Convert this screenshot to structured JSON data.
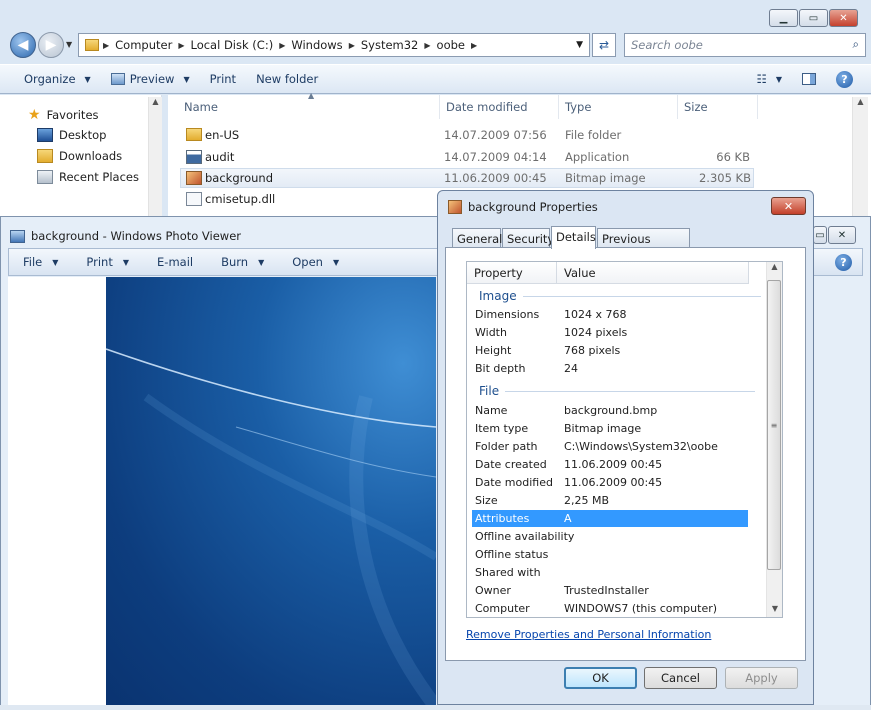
{
  "explorer": {
    "breadcrumbs": [
      "Computer",
      "Local Disk (C:)",
      "Windows",
      "System32",
      "oobe"
    ],
    "search_placeholder": "Search oobe",
    "toolbar": {
      "organize": "Organize",
      "preview": "Preview",
      "print": "Print",
      "new_folder": "New folder"
    },
    "nav": [
      {
        "label": "Favorites"
      },
      {
        "label": "Desktop"
      },
      {
        "label": "Downloads"
      },
      {
        "label": "Recent Places"
      }
    ],
    "columns": {
      "name": "Name",
      "date": "Date modified",
      "type": "Type",
      "size": "Size"
    },
    "files": [
      {
        "name": "en-US",
        "date": "14.07.2009 07:56",
        "type": "File folder",
        "size": ""
      },
      {
        "name": "audit",
        "date": "14.07.2009 04:14",
        "type": "Application",
        "size": "66 KB"
      },
      {
        "name": "background",
        "date": "11.06.2009 00:45",
        "type": "Bitmap image",
        "size": "2.305 KB"
      },
      {
        "name": "cmisetup.dll",
        "date": "",
        "type": "",
        "size": ""
      }
    ]
  },
  "viewer": {
    "title": "background - Windows Photo Viewer",
    "menu": {
      "file": "File",
      "print": "Print",
      "email": "E-mail",
      "burn": "Burn",
      "open": "Open"
    }
  },
  "dialog": {
    "title": "background Properties",
    "tabs": [
      "General",
      "Security",
      "Details",
      "Previous Versions"
    ],
    "headers": {
      "property": "Property",
      "value": "Value"
    },
    "groups": {
      "image": "Image",
      "file": "File"
    },
    "image_props": [
      {
        "k": "Dimensions",
        "v": "1024 x 768"
      },
      {
        "k": "Width",
        "v": "1024 pixels"
      },
      {
        "k": "Height",
        "v": "768 pixels"
      },
      {
        "k": "Bit depth",
        "v": "24"
      }
    ],
    "file_props": [
      {
        "k": "Name",
        "v": "background.bmp"
      },
      {
        "k": "Item type",
        "v": "Bitmap image"
      },
      {
        "k": "Folder path",
        "v": "C:\\Windows\\System32\\oobe"
      },
      {
        "k": "Date created",
        "v": "11.06.2009 00:45"
      },
      {
        "k": "Date modified",
        "v": "11.06.2009 00:45"
      },
      {
        "k": "Size",
        "v": "2,25 MB"
      },
      {
        "k": "Attributes",
        "v": "A"
      },
      {
        "k": "Offline availability",
        "v": ""
      },
      {
        "k": "Offline status",
        "v": ""
      },
      {
        "k": "Shared with",
        "v": ""
      },
      {
        "k": "Owner",
        "v": "TrustedInstaller"
      },
      {
        "k": "Computer",
        "v": "WINDOWS7 (this computer)"
      }
    ],
    "link": "Remove Properties and Personal Information",
    "buttons": {
      "ok": "OK",
      "cancel": "Cancel",
      "apply": "Apply"
    }
  }
}
